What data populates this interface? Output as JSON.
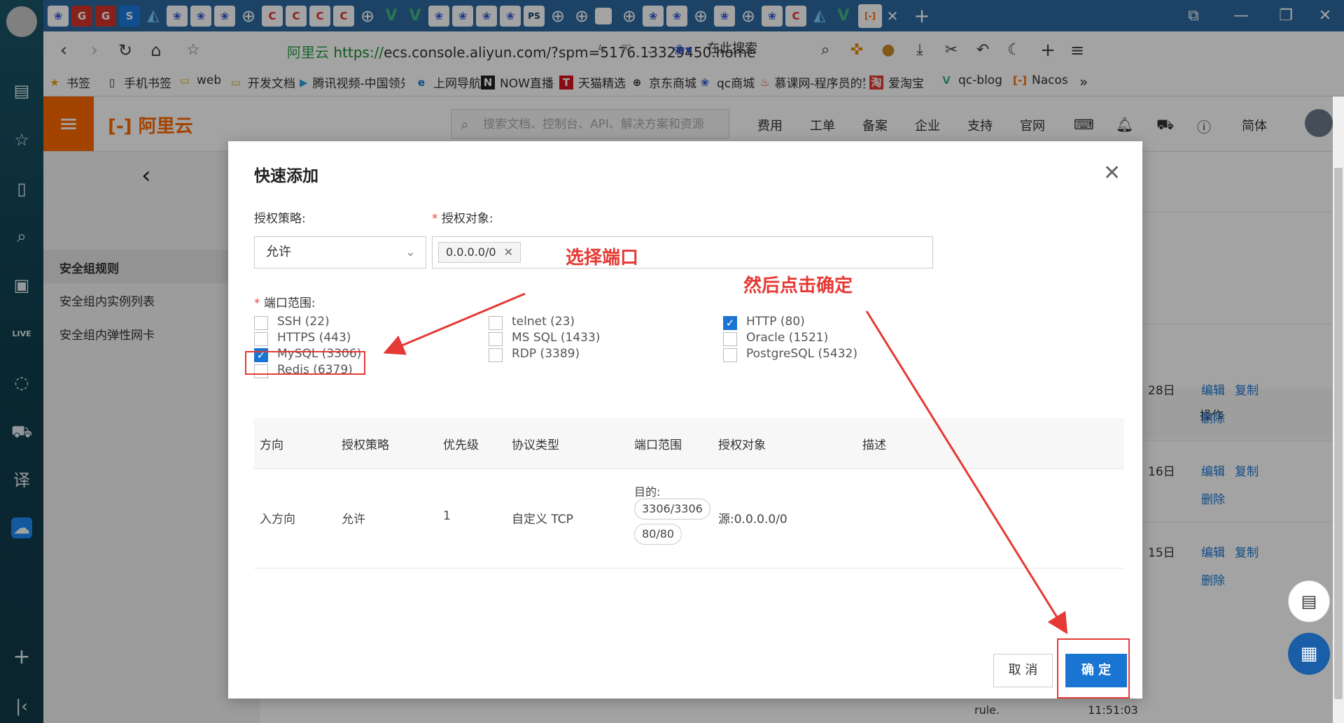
{
  "browser": {
    "window_controls": [
      "⧉",
      "—",
      "❐",
      "✕"
    ],
    "address_bar": {
      "site_name": "阿里云",
      "url_scheme": "https://",
      "url_rest": "ecs.console.aliyun.com/?spm=5176.13329450.home",
      "search_placeholder": "在此搜索"
    },
    "bookmarks": [
      {
        "label": "书签",
        "icon": "star-icon"
      },
      {
        "label": "手机书签",
        "icon": "phone-icon"
      },
      {
        "label": "web",
        "icon": "folder-icon"
      },
      {
        "label": "开发文档",
        "icon": "folder-icon"
      },
      {
        "label": "腾讯视频-中国领先",
        "icon": "tencent-video-icon"
      },
      {
        "label": "上网导航",
        "icon": "ie-icon"
      },
      {
        "label": "NOW直播",
        "icon": "now-icon"
      },
      {
        "label": "天猫精选",
        "icon": "tmall-icon"
      },
      {
        "label": "京东商城",
        "icon": "globe-icon"
      },
      {
        "label": "qc商城",
        "icon": "baidu-paw-icon"
      },
      {
        "label": "慕课网-程序员的梦",
        "icon": "fire-icon"
      },
      {
        "label": "爱淘宝",
        "icon": "taobao-icon"
      },
      {
        "label": "qc-blog",
        "icon": "vue-icon"
      },
      {
        "label": "Nacos",
        "icon": "aliyun-icon"
      }
    ]
  },
  "console": {
    "logo_text": "阿里云",
    "search_placeholder": "搜索文档、控制台、API、解决方案和资源",
    "nav": [
      "费用",
      "工单",
      "备案",
      "企业",
      "支持",
      "官网",
      "简体"
    ],
    "sidebar": {
      "items": [
        "安全组规则",
        "安全组内实例列表",
        "安全组内弹性网卡"
      ]
    },
    "background_table": {
      "header_action": "操作",
      "rows": [
        {
          "date_fragment": "28日",
          "actions": [
            "编辑",
            "复制",
            "删除"
          ]
        },
        {
          "date_fragment": "16日",
          "actions": [
            "编辑",
            "复制",
            "删除"
          ]
        },
        {
          "date_fragment": "15日",
          "actions": [
            "编辑",
            "复制",
            "删除"
          ]
        }
      ],
      "fragment_rule": "rule.",
      "fragment_time": "11:51:03"
    }
  },
  "modal": {
    "title": "快速添加",
    "policy_label": "授权策略:",
    "target_label": "授权对象:",
    "policy_value": "允许",
    "target_tag": "0.0.0.0/0",
    "port_label": "端口范围:",
    "ports": [
      {
        "label": "SSH (22)",
        "checked": false
      },
      {
        "label": "HTTPS (443)",
        "checked": false
      },
      {
        "label": "MySQL (3306)",
        "checked": true
      },
      {
        "label": "Redis (6379)",
        "checked": false
      },
      {
        "label": "telnet (23)",
        "checked": false
      },
      {
        "label": "MS SQL (1433)",
        "checked": false
      },
      {
        "label": "RDP (3389)",
        "checked": false
      },
      {
        "label": "HTTP (80)",
        "checked": true
      },
      {
        "label": "Oracle (1521)",
        "checked": false
      },
      {
        "label": "PostgreSQL (5432)",
        "checked": false
      }
    ],
    "table": {
      "headers": [
        "方向",
        "授权策略",
        "优先级",
        "协议类型",
        "端口范围",
        "授权对象",
        "描述"
      ],
      "row": {
        "direction": "入方向",
        "policy": "允许",
        "priority": "1",
        "protocol": "自定义 TCP",
        "port_prefix": "目的:",
        "ports": [
          "3306/3306",
          "80/80"
        ],
        "target": "源:0.0.0.0/0",
        "description": ""
      }
    },
    "cancel_label": "取 消",
    "ok_label": "确 定"
  },
  "annotations": {
    "select_port": "选择端口",
    "then_confirm": "然后点击确定",
    "color": "#e53935"
  },
  "colors": {
    "brand_orange": "#ff6a00",
    "primary_blue": "#1a75d2"
  }
}
